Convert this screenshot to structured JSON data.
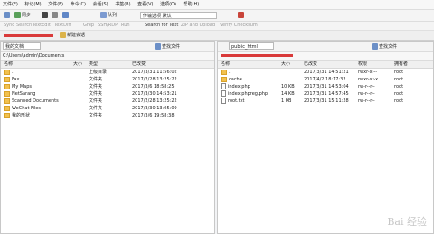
{
  "menu": [
    "文件(F)",
    "标记(M)",
    "文件(F)",
    "命令(C)",
    "会话(S)",
    "书签(B)",
    "查看(V)",
    "选项(O)",
    "帮助(H)"
  ],
  "toolbar": {
    "sync_label": "同步",
    "queue_label": "队列",
    "transfer_settings_value": "传输选项 默认"
  },
  "toolbar2": {
    "items": [
      "Sync",
      "Search",
      "TextEdit",
      "TextDiff",
      "Grep",
      "SSH/RDP",
      "Run",
      "Search for Text",
      "ZIP and Upload",
      "Verify Checksum"
    ]
  },
  "session": {
    "new_session_label": "新建会话"
  },
  "left_pane": {
    "location": "我的文档",
    "path": "C:\\Users\\admin\\Documents",
    "search_label": "查找文件",
    "columns": [
      "名称",
      "大小",
      "类型",
      "已改变"
    ],
    "rows": [
      {
        "name": "..",
        "size": "",
        "type": "上级目录",
        "changed": "2017/3/31 11:56:02"
      },
      {
        "name": "Fax",
        "size": "",
        "type": "文件夹",
        "changed": "2017/2/28 13:25:22"
      },
      {
        "name": "My Maps",
        "size": "",
        "type": "文件夹",
        "changed": "2017/3/6 18:58:25"
      },
      {
        "name": "NetSarang",
        "size": "",
        "type": "文件夹",
        "changed": "2017/3/30 14:53:21"
      },
      {
        "name": "Scanned Documents",
        "size": "",
        "type": "文件夹",
        "changed": "2017/2/28 13:25:22"
      },
      {
        "name": "WeChat Files",
        "size": "",
        "type": "文件夹",
        "changed": "2017/3/30 13:05:09"
      },
      {
        "name": "我的形状",
        "size": "",
        "type": "文件夹",
        "changed": "2017/3/6 19:58:38"
      }
    ]
  },
  "right_pane": {
    "location": "public_html",
    "search_label": "查找文件",
    "columns": [
      "名称",
      "大小",
      "已改变",
      "权限",
      "拥有者"
    ],
    "rows": [
      {
        "name": "..",
        "size": "",
        "changed": "2017/3/31 14:51:21",
        "perm": "rwxr-x---",
        "owner": "root",
        "kind": "folder"
      },
      {
        "name": "cache",
        "size": "",
        "changed": "2017/4/2 18:17:32",
        "perm": "rwxr-xr-x",
        "owner": "root",
        "kind": "folder"
      },
      {
        "name": "index.php",
        "size": "10 KB",
        "changed": "2017/3/31 14:53:04",
        "perm": "rw-r--r--",
        "owner": "root",
        "kind": "file"
      },
      {
        "name": "index.phpreg.php",
        "size": "14 KB",
        "changed": "2017/3/31 14:57:45",
        "perm": "rw-r--r--",
        "owner": "root",
        "kind": "file"
      },
      {
        "name": "root.txt",
        "size": "1 KB",
        "changed": "2017/3/31 15:11:28",
        "perm": "rw-r--r--",
        "owner": "root",
        "kind": "file"
      }
    ]
  },
  "watermark": "Bai 经验",
  "colors": {
    "accent_red": "#d93a3a",
    "folder": "#f2c14e"
  }
}
